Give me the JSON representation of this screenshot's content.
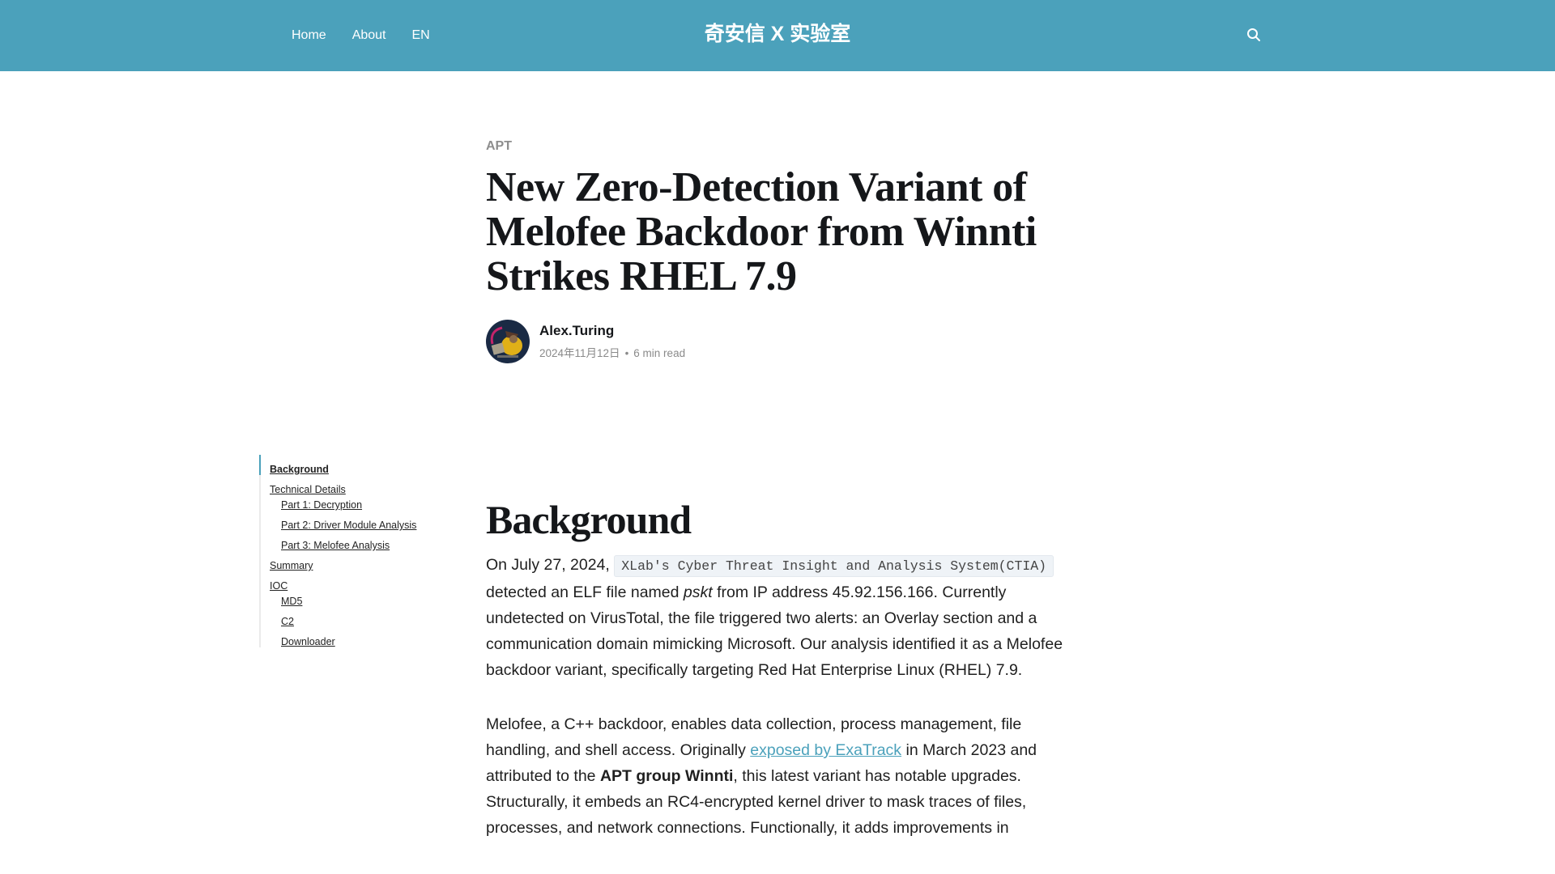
{
  "header": {
    "nav": [
      {
        "label": "Home"
      },
      {
        "label": "About"
      },
      {
        "label": "EN"
      }
    ],
    "brand": "奇安信 X 实验室",
    "search_icon": "search-icon",
    "background_color": "#4ba1bb"
  },
  "article": {
    "category": "APT",
    "title": "New Zero-Detection Variant of Melofee Backdoor from Winnti Strikes RHEL 7.9",
    "author": {
      "name": "Alex.Turing",
      "date": "2024年11月12日",
      "separator": "•",
      "read_time": "6 min read"
    }
  },
  "toc": {
    "items": [
      {
        "label": "Background",
        "level": 1,
        "active": true
      },
      {
        "label": "Technical Details",
        "level": 1
      },
      {
        "label": "Part 1: Decryption",
        "level": 2
      },
      {
        "label": "Part 2: Driver Module Analysis",
        "level": 2
      },
      {
        "label": "Part 3: Melofee Analysis",
        "level": 2
      },
      {
        "label": "Summary",
        "level": 1
      },
      {
        "label": "IOC",
        "level": 1
      },
      {
        "label": "MD5",
        "level": 2
      },
      {
        "label": "C2",
        "level": 2
      },
      {
        "label": "Downloader",
        "level": 2
      }
    ]
  },
  "content": {
    "heading": "Background",
    "p1": {
      "t1": "On July 27, 2024, ",
      "code": "XLab's Cyber Threat Insight and Analysis System(CTIA)",
      "t2": " detected an ELF file named ",
      "em": "pskt",
      "t3": " from IP address 45.92.156.166. Currently undetected on VirusTotal, the file triggered two alerts: an Overlay section and a communication domain mimicking Microsoft. Our analysis identified it as a Melofee backdoor variant, specifically targeting Red Hat Enterprise Linux (RHEL) 7.9."
    },
    "p2": {
      "t1": "Melofee, a C++ backdoor, enables data collection, process management, file handling, and shell access. Originally ",
      "link": "exposed by ExaTrack",
      "t2": " in March 2023 and attributed to the ",
      "strong": "APT group Winnti",
      "t3": ", this latest variant has notable upgrades. Structurally, it embeds an RC4-encrypted kernel driver to mask traces of files, processes, and network connections. Functionally, it adds improvements in"
    }
  }
}
